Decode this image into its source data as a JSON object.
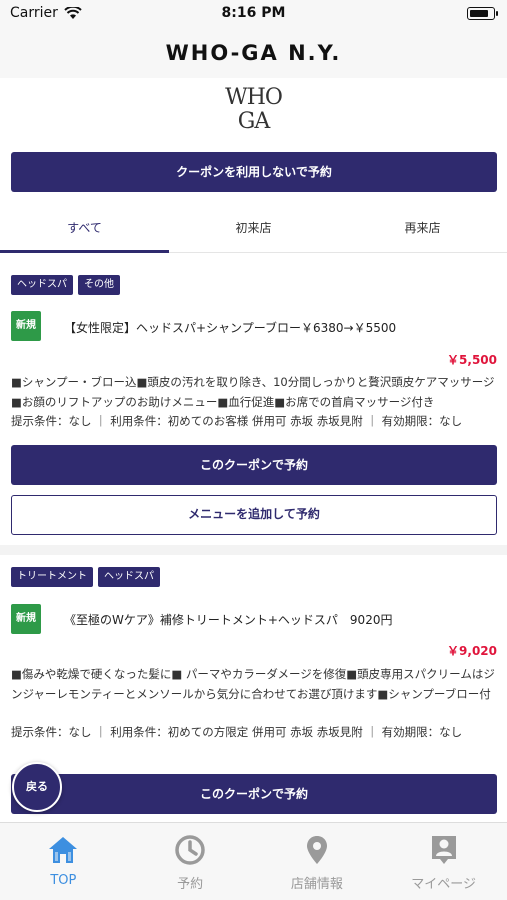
{
  "status_bar": {
    "carrier": "Carrier",
    "time": "8:16 PM"
  },
  "header": {
    "title": "WHO-GA N.Y."
  },
  "logo": {
    "line1": "WHO",
    "line2": "GA"
  },
  "no_coupon_button": "クーポンを利用しないで予約",
  "tabs": [
    {
      "label": "すべて",
      "active": true
    },
    {
      "label": "初来店",
      "active": false
    },
    {
      "label": "再来店",
      "active": false
    }
  ],
  "coupons": [
    {
      "tags": [
        "ヘッドスパ",
        "その他"
      ],
      "badge": "新規",
      "title": "【女性限定】ヘッドスパ+シャンプーブロー￥6380→￥5500",
      "price": "￥5,500",
      "description": "■シャンプー・ブロー込■頭皮の汚れを取り除き、10分間しっかりと贅沢頭皮ケアマッサージ■お顔のリフトアップのお助けメニュー■血行促進■お席での首肩マッサージ付き",
      "terms": "提示条件：なし ｜ 利用条件：初めてのお客様 併用可 赤坂 赤坂見附 ｜ 有効期限：なし",
      "reserve_label": "このクーポンで予約",
      "add_menu_label": "メニューを追加して予約"
    },
    {
      "tags": [
        "トリートメント",
        "ヘッドスパ"
      ],
      "badge": "新規",
      "title": "《至極のWケア》補修トリートメント+ヘッドスパ　9020円",
      "price": "￥9,020",
      "description": "■傷みや乾燥で硬くなった髪に■ パーマやカラーダメージを修復■頭皮専用スパクリームはジンジャーレモンティーとメンソールから気分に合わせてお選び頂けます■シャンプーブロー付",
      "terms": "提示条件：なし ｜ 利用条件：初めての方限定 併用可 赤坂 赤坂見附 ｜ 有効期限：なし",
      "reserve_label": "このクーポンで予約"
    }
  ],
  "back_button": "戻る",
  "tabbar": [
    {
      "label": "TOP",
      "icon": "home-icon",
      "active": true
    },
    {
      "label": "予約",
      "icon": "clock-icon",
      "active": false
    },
    {
      "label": "店舗情報",
      "icon": "location-pin-icon",
      "active": false
    },
    {
      "label": "マイページ",
      "icon": "user-badge-icon",
      "active": false
    }
  ],
  "colors": {
    "primary": "#2f2a6e",
    "price": "#e0153c",
    "new_badge": "#2e9a48",
    "tab_active": "#3d8fe0"
  }
}
